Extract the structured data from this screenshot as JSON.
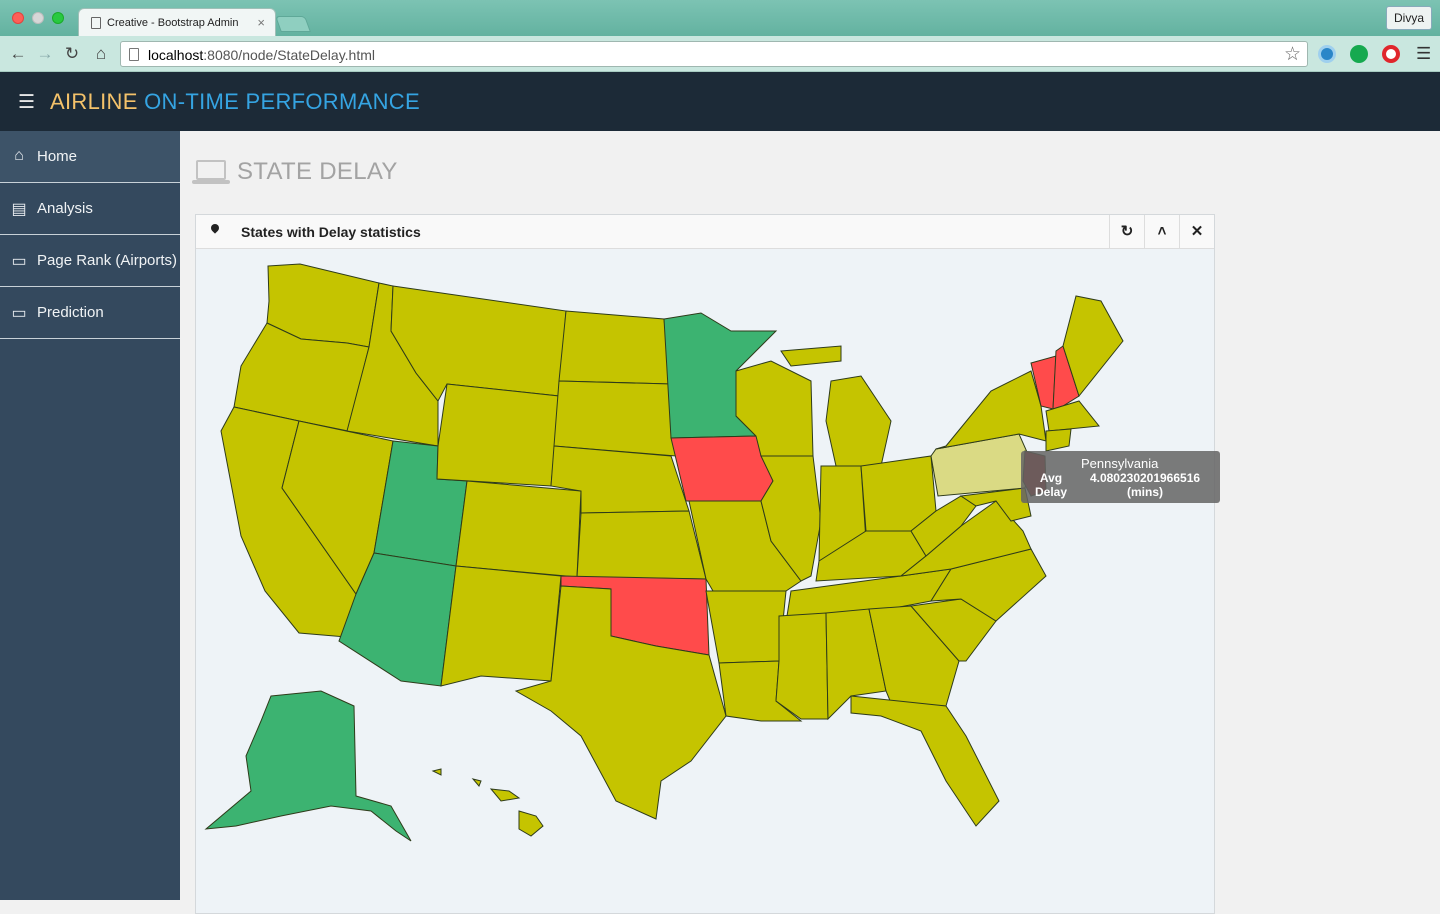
{
  "browser": {
    "tab_title": "Creative - Bootstrap Admin",
    "profile": "Divya",
    "url_host": "localhost",
    "url_path": ":8080/node/StateDelay.html"
  },
  "header": {
    "brand_part1": "AIRLINE",
    "brand_part2": "ON-TIME PERFORMANCE"
  },
  "sidebar": {
    "items": [
      {
        "label": "Home",
        "icon": "home-icon"
      },
      {
        "label": "Analysis",
        "icon": "document-icon"
      },
      {
        "label": "Page Rank (Airports)",
        "icon": "monitor-icon"
      },
      {
        "label": "Prediction",
        "icon": "monitor-icon"
      }
    ]
  },
  "page": {
    "title": "STATE DELAY"
  },
  "panel": {
    "title": "States with Delay statistics",
    "buttons": [
      "refresh-icon",
      "chevron-up-icon",
      "close-icon"
    ]
  },
  "map": {
    "colors": {
      "default": "#c5c400",
      "green": "#3cb371",
      "red": "#ff4b4b",
      "hover": "#dada84",
      "dark_red": "#9e2a2a"
    },
    "states": {
      "Minnesota": "green",
      "Utah": "green",
      "Arizona": "green",
      "Alaska": "green",
      "Iowa": "red",
      "Oklahoma": "red",
      "Vermont": "red",
      "New Hampshire": "red",
      "Pennsylvania": "hover",
      "New Jersey": "dark_red"
    }
  },
  "tooltip": {
    "name": "Pennsylvania",
    "label_line1": "Avg",
    "label_line2": "Delay",
    "value": "4.080230201966516",
    "unit": "(mins)"
  }
}
